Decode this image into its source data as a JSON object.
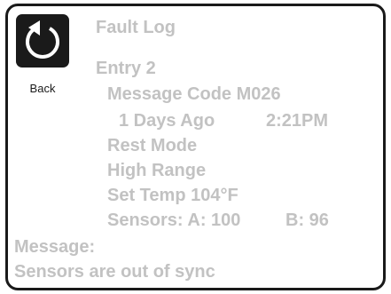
{
  "nav": {
    "back_label": "Back"
  },
  "header": {
    "title": "Fault Log"
  },
  "entry": {
    "label": "Entry 2",
    "message_code": "Message Code M026",
    "age": "1 Days Ago",
    "time": "2:21PM",
    "mode": "Rest Mode",
    "range": "High Range",
    "set_temp": "Set Temp 104°F",
    "sensor_a": "Sensors: A: 100",
    "sensor_b": "B: 96"
  },
  "message": {
    "label": "Message:",
    "text": "Sensors are out of sync"
  },
  "colors": {
    "text_gray": "#c2c2c2",
    "icon_bg": "#1a1a1a",
    "background": "#ffffff"
  },
  "icons": {
    "back": "counterclockwise-arrow"
  }
}
